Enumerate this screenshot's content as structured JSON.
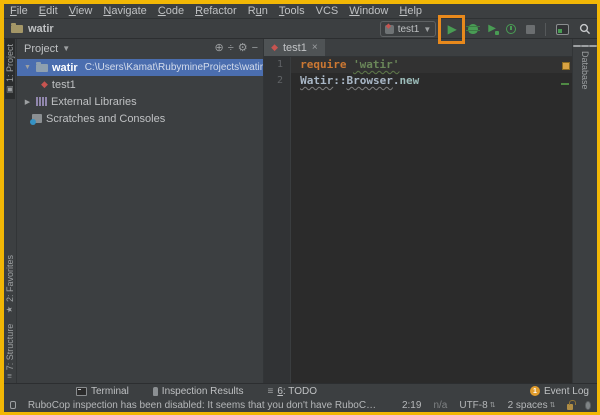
{
  "colors": {
    "window_border": "#f2b705",
    "highlight_box": "#e8891c",
    "selection_blue": "#4b6eaf",
    "run_green": "#499c54",
    "warning_marker": "#d9a343",
    "editor_bg": "#2b2b2b",
    "panel_bg": "#3c3f41"
  },
  "menu": {
    "items": [
      {
        "label": "File",
        "m": 0
      },
      {
        "label": "Edit",
        "m": 0
      },
      {
        "label": "View",
        "m": 0
      },
      {
        "label": "Navigate",
        "m": 0
      },
      {
        "label": "Code",
        "m": 0
      },
      {
        "label": "Refactor",
        "m": 0
      },
      {
        "label": "Run",
        "m": 1
      },
      {
        "label": "Tools",
        "m": 0
      },
      {
        "label": "VCS",
        "m": -1
      },
      {
        "label": "Window",
        "m": 0
      },
      {
        "label": "Help",
        "m": 0
      }
    ]
  },
  "navbar": {
    "breadcrumb": "watir",
    "run_config": "test1"
  },
  "project_panel": {
    "title": "Project",
    "tree": {
      "root_name": "watir",
      "root_path": "C:\\Users\\Kamat\\RubymineProjects\\watir",
      "file": "test1",
      "external": "External Libraries",
      "scratches": "Scratches and Consoles"
    }
  },
  "editor": {
    "tab": "test1",
    "tab_close": "×",
    "lines": [
      {
        "num": "1",
        "tokens": [
          {
            "text": "require ",
            "cls": "kw"
          },
          {
            "text": "'watir'",
            "cls": "str"
          }
        ]
      },
      {
        "num": "2",
        "tokens": [
          {
            "text": "Watir",
            "cls": "const"
          },
          {
            "text": "::",
            "cls": "plain"
          },
          {
            "text": "Browser",
            "cls": "const"
          },
          {
            "text": ".",
            "cls": "plain"
          },
          {
            "text": "new",
            "cls": "method"
          }
        ]
      }
    ]
  },
  "stripes": {
    "left_top": "1: Project",
    "left_bottom_1": "2: Favorites",
    "left_bottom_2": "7: Structure",
    "right_1": "Database"
  },
  "bottom_bar": {
    "terminal": "Terminal",
    "inspection": "Inspection Results",
    "todo_num": "6",
    "todo_rest": ": TODO",
    "event_log": "Event Log",
    "event_badge": "1"
  },
  "status_bar": {
    "message": "RuboCop inspection has been disabled: It seems that you don't have RuboCop installed in current project S... (a minute ago)",
    "caret_position": "2:19",
    "na": "n/a",
    "encoding": "UTF-8",
    "indent": "2 spaces"
  }
}
